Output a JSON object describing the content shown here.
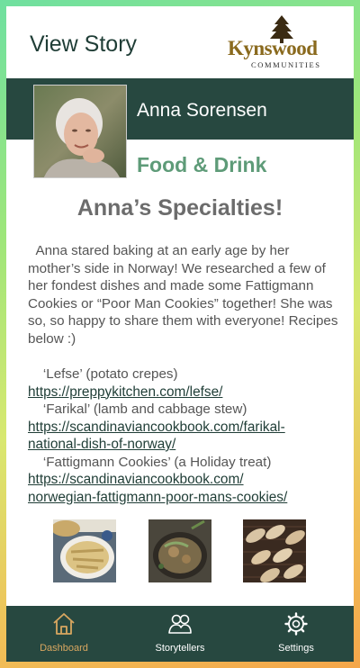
{
  "header": {
    "title": "View Story",
    "logo_word": "Kynswood",
    "logo_sub": "COMMUNITIES"
  },
  "profile": {
    "name": "Anna Sorensen",
    "category": "Food & Drink"
  },
  "story": {
    "title": "Anna’s Specialties!",
    "body": "  Anna stared baking at an early age by her mother’s side in Norway! We researched a few of her fondest dishes and made some Fattigmann Cookies or “Poor Man Cookies” together! She was so, so happy to share them with everyone! Recipes below :)",
    "recipes": [
      {
        "label": "    ‘Lefse’ (potato crepes)",
        "link_lines": [
          "https://preppykitchen.com/lefse/"
        ]
      },
      {
        "label": "    ‘Farikal’ (lamb and cabbage stew)",
        "link_lines": [
          "https://scandinaviancookbook.com/farikal-",
          "national-dish-of-norway/"
        ]
      },
      {
        "label": "    ‘Fattigmann Cookies’ (a Holiday treat)",
        "link_lines": [
          "https://scandinaviancookbook.com/",
          "norwegian-fattigmann-poor-mans-cookies/"
        ]
      }
    ]
  },
  "photos": [
    {
      "name": "lefse-photo"
    },
    {
      "name": "farikal-photo"
    },
    {
      "name": "fattigmann-photo"
    }
  ],
  "nav": {
    "items": [
      {
        "label": "Dashboard",
        "icon": "home-icon",
        "active": true
      },
      {
        "label": "Storytellers",
        "icon": "people-icon",
        "active": false
      },
      {
        "label": "Settings",
        "icon": "gear-icon",
        "active": false
      }
    ],
    "active_color": "#d9a760",
    "inactive_color": "#ffffff"
  },
  "colors": {
    "brand_dark": "#274840",
    "accent_green": "#5e9b78"
  }
}
